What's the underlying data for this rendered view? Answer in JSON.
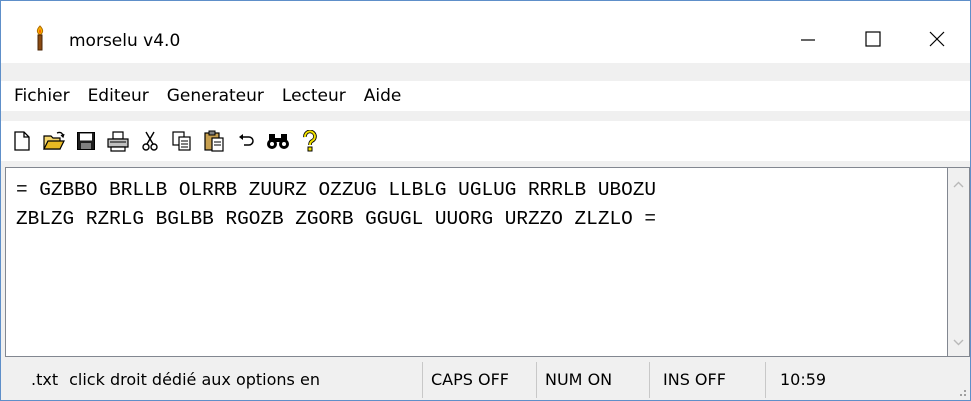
{
  "window": {
    "title": "morselu v4.0",
    "controls": {
      "minimize": "—",
      "maximize": "☐",
      "close": "✕"
    }
  },
  "menu": {
    "items": [
      "Fichier",
      "Editeur",
      "Generateur",
      "Lecteur",
      "Aide"
    ]
  },
  "toolbar": {
    "buttons": [
      "new-file-icon",
      "open-folder-icon",
      "save-icon",
      "print-icon",
      "cut-icon",
      "copy-icon",
      "paste-icon",
      "undo-icon",
      "find-icon",
      "help-icon"
    ]
  },
  "editor": {
    "lines": [
      "= GZBBO BRLLB OLRRB ZUURZ OZZUG LLBLG UGLUG RRRLB UBOZU",
      "ZBLZG RZRLG BGLBB RGOZB ZGORB GGUGL UUORG URZZO ZLZLO ="
    ]
  },
  "statusbar": {
    "file": ".txt",
    "message": "click droit dédié aux options en",
    "caps": "CAPS OFF",
    "num": "NUM ON",
    "ins": "INS OFF",
    "time": "10:59"
  },
  "colors": {
    "window_border": "#5e8fc9",
    "chrome": "#f0f0f0",
    "editor_bg": "#ffffff"
  }
}
